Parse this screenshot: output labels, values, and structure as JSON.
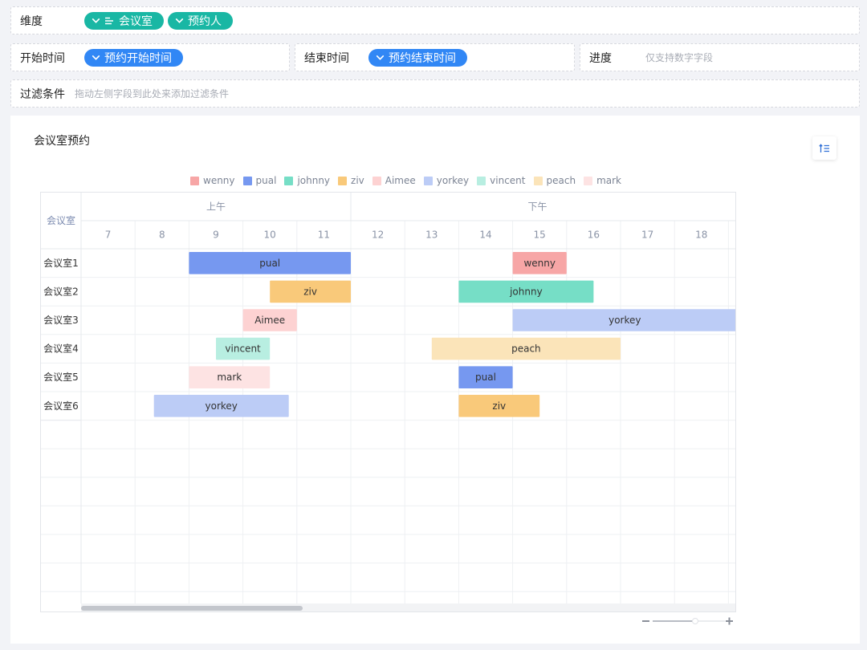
{
  "dimension_row": {
    "label": "维度",
    "pills": [
      "会议室",
      "预约人"
    ]
  },
  "start_time": {
    "label": "开始时间",
    "pill": "预约开始时间"
  },
  "end_time": {
    "label": "结束时间",
    "pill": "预约结束时间"
  },
  "progress": {
    "label": "进度",
    "hint": "仅支持数字字段"
  },
  "filter": {
    "label": "过滤条件",
    "hint": "拖动左侧字段到此处来添加过滤条件"
  },
  "chart_title": "会议室预约",
  "icons": {
    "sort": "sort-ascending-icon",
    "chevron": "chevron-down-icon",
    "bars": "align-left-bars-icon"
  },
  "colors": {
    "wenny": "#f7a6a6",
    "pual": "#7698f0",
    "johnny": "#76dec6",
    "ziv": "#f9c97a",
    "Aimee": "#fdd2d2",
    "yorkey": "#bcccf6",
    "vincent": "#b8eee1",
    "peach": "#fbe4b9",
    "mark": "#fde3e3"
  },
  "chart_data": {
    "type": "gantt",
    "legend": [
      "wenny",
      "pual",
      "johnny",
      "ziv",
      "Aimee",
      "yorkey",
      "vincent",
      "peach",
      "mark"
    ],
    "row_header": "会议室",
    "period_headers": [
      "上午",
      "下午"
    ],
    "hours": [
      "7",
      "8",
      "9",
      "10",
      "11",
      "12",
      "13",
      "14",
      "15",
      "16",
      "17",
      "18"
    ],
    "rows": [
      "会议室1",
      "会议室2",
      "会议室3",
      "会议室4",
      "会议室5",
      "会议室6"
    ],
    "tasks": [
      {
        "row": 0,
        "name": "pual",
        "start": 9,
        "end": 12
      },
      {
        "row": 0,
        "name": "wenny",
        "start": 15,
        "end": 16
      },
      {
        "row": 1,
        "name": "ziv",
        "start": 10.5,
        "end": 12
      },
      {
        "row": 1,
        "name": "johnny",
        "start": 14,
        "end": 16.5
      },
      {
        "row": 2,
        "name": "Aimee",
        "start": 10,
        "end": 11
      },
      {
        "row": 2,
        "name": "yorkey",
        "start": 15,
        "end": 19.2
      },
      {
        "row": 3,
        "name": "vincent",
        "start": 9.5,
        "end": 10.5
      },
      {
        "row": 3,
        "name": "peach",
        "start": 13.5,
        "end": 17
      },
      {
        "row": 4,
        "name": "mark",
        "start": 9,
        "end": 10.5
      },
      {
        "row": 4,
        "name": "pual",
        "start": 14,
        "end": 15
      },
      {
        "row": 5,
        "name": "yorkey",
        "start": 8.35,
        "end": 10.85
      },
      {
        "row": 5,
        "name": "ziv",
        "start": 14,
        "end": 15.5
      }
    ]
  }
}
